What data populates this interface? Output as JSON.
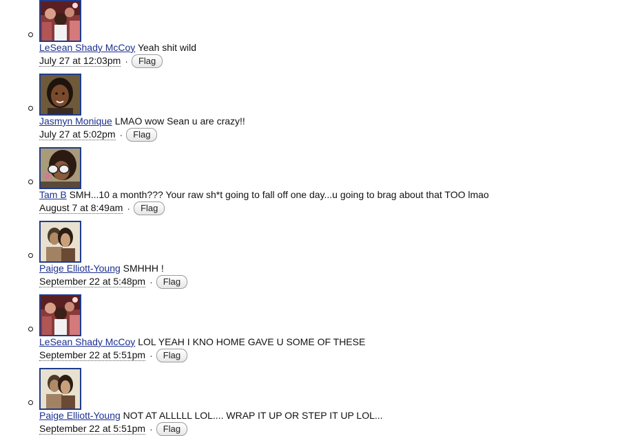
{
  "comments": [
    {
      "author": "LeSean Shady McCoy",
      "text": " Yeah shit wild",
      "time": "July 27 at 12:03pm",
      "flag": "Flag",
      "avatar": "party-photo"
    },
    {
      "author": "Jasmyn Monique",
      "text": " LMAO wow Sean u are crazy!!",
      "time": "July 27 at 5:02pm",
      "flag": "Flag",
      "avatar": "portrait-photo"
    },
    {
      "author": "Tam B",
      "text": " SMH...10 a month??? Your raw sh*t going to fall off one day...u going to brag about that TOO lmao",
      "time": "August 7 at 8:49am",
      "flag": "Flag",
      "avatar": "sunglasses-photo"
    },
    {
      "author": "Paige Elliott-Young",
      "text": " SMHHH !",
      "time": "September 22 at 5:48pm",
      "flag": "Flag",
      "avatar": "couple-photo"
    },
    {
      "author": "LeSean Shady McCoy",
      "text": " LOL YEAH I KNO HOME GAVE U SOME OF THESE",
      "time": "September 22 at 5:51pm",
      "flag": "Flag",
      "avatar": "party-photo"
    },
    {
      "author": "Paige Elliott-Young",
      "text": " NOT AT ALLLLL LOL.... WRAP IT UP OR STEP IT UP LOL...",
      "time": "September 22 at 5:51pm",
      "flag": "Flag",
      "avatar": "couple-photo"
    }
  ]
}
